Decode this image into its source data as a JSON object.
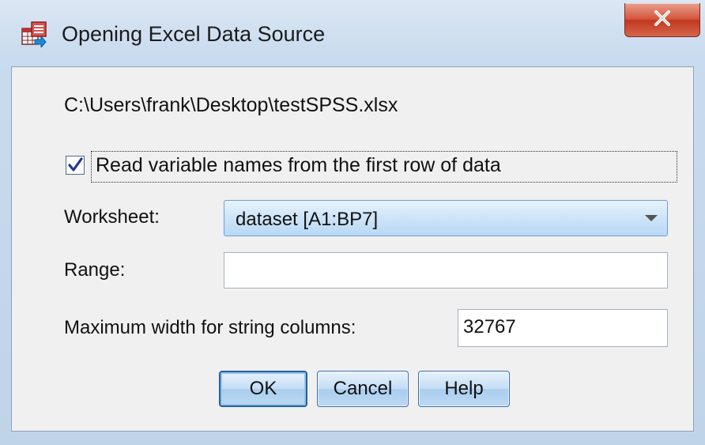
{
  "window": {
    "title": "Opening Excel Data Source",
    "icons": {
      "app": "spss-excel-data-icon",
      "close": "close-icon"
    }
  },
  "dialog": {
    "file_path": "C:\\Users\\frank\\Desktop\\testSPSS.xlsx",
    "read_names": {
      "label": "Read variable names from the first row of data",
      "checked": true
    },
    "worksheet": {
      "label": "Worksheet:",
      "selected": "dataset [A1:BP7]"
    },
    "range": {
      "label": "Range:",
      "value": ""
    },
    "max_width": {
      "label": "Maximum width for string columns:",
      "value": "32767"
    },
    "buttons": {
      "ok": "OK",
      "cancel": "Cancel",
      "help": "Help"
    }
  },
  "colors": {
    "title_bg": "#c9dbee",
    "client_bg": "#f0f0f0",
    "accent": "#3c6fa6",
    "close": "#c0391f"
  }
}
